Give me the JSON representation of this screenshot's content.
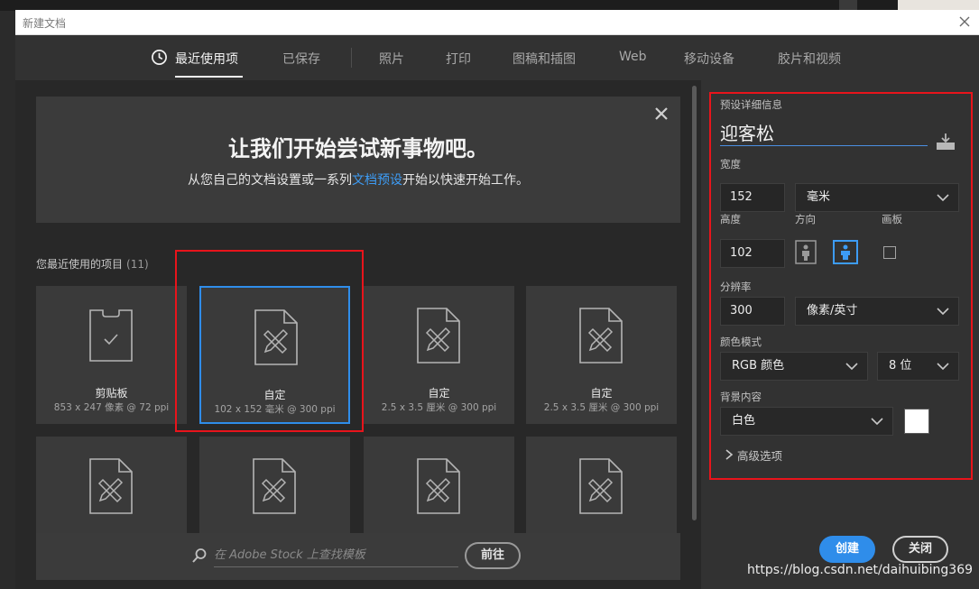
{
  "dialog": {
    "title": "新建文档"
  },
  "tabs": [
    {
      "label": "最近使用项",
      "active": true
    },
    {
      "label": "已保存"
    },
    {
      "label": "照片"
    },
    {
      "label": "打印"
    },
    {
      "label": "图稿和插图"
    },
    {
      "label": "Web"
    },
    {
      "label": "移动设备"
    },
    {
      "label": "胶片和视频"
    }
  ],
  "banner": {
    "headline": "让我们开始尝试新事物吧。",
    "sub_before": "从您自己的文档设置或一系列",
    "sub_link": "文档预设",
    "sub_after": "开始以快速开始工作。"
  },
  "recent": {
    "label": "您最近使用的项目",
    "count": "(11)",
    "items": [
      {
        "name": "剪贴板",
        "meta": "853 x 247 像素 @ 72 ppi",
        "icon": "clipboard-icon"
      },
      {
        "name": "自定",
        "meta": "102 x 152 毫米 @ 300 ppi",
        "icon": "document-icon",
        "selected": true
      },
      {
        "name": "自定",
        "meta": "2.5 x 3.5 厘米 @ 300 ppi",
        "icon": "document-icon"
      },
      {
        "name": "自定",
        "meta": "2.5 x 3.5 厘米 @ 300 ppi",
        "icon": "document-icon"
      },
      {
        "icon": "document-icon"
      },
      {
        "icon": "document-icon"
      },
      {
        "icon": "document-icon"
      },
      {
        "icon": "document-icon"
      }
    ]
  },
  "stock": {
    "placeholder": "在 Adobe Stock 上查找模板",
    "go_label": "前往"
  },
  "preset": {
    "section_label": "预设详细信息",
    "name": "迎客松",
    "width_label": "宽度",
    "width_value": "152",
    "unit": "毫米",
    "height_label": "高度",
    "height_value": "102",
    "orientation_label": "方向",
    "orientation_selected": "landscape",
    "artboard_label": "画板",
    "artboard_checked": false,
    "resolution_label": "分辨率",
    "resolution_value": "300",
    "resolution_unit": "像素/英寸",
    "color_mode_label": "颜色模式",
    "color_mode": "RGB 颜色",
    "bit_depth": "8 位",
    "background_label": "背景内容",
    "background": "白色",
    "background_color": "#ffffff",
    "advanced_label": "高级选项"
  },
  "actions": {
    "create_label": "创建",
    "close_label": "关闭"
  },
  "watermark": "https://blog.csdn.net/daihuibing369",
  "colors": {
    "accent": "#2f8dea",
    "link": "#3d9cf5",
    "highlight": "#e8141b"
  }
}
